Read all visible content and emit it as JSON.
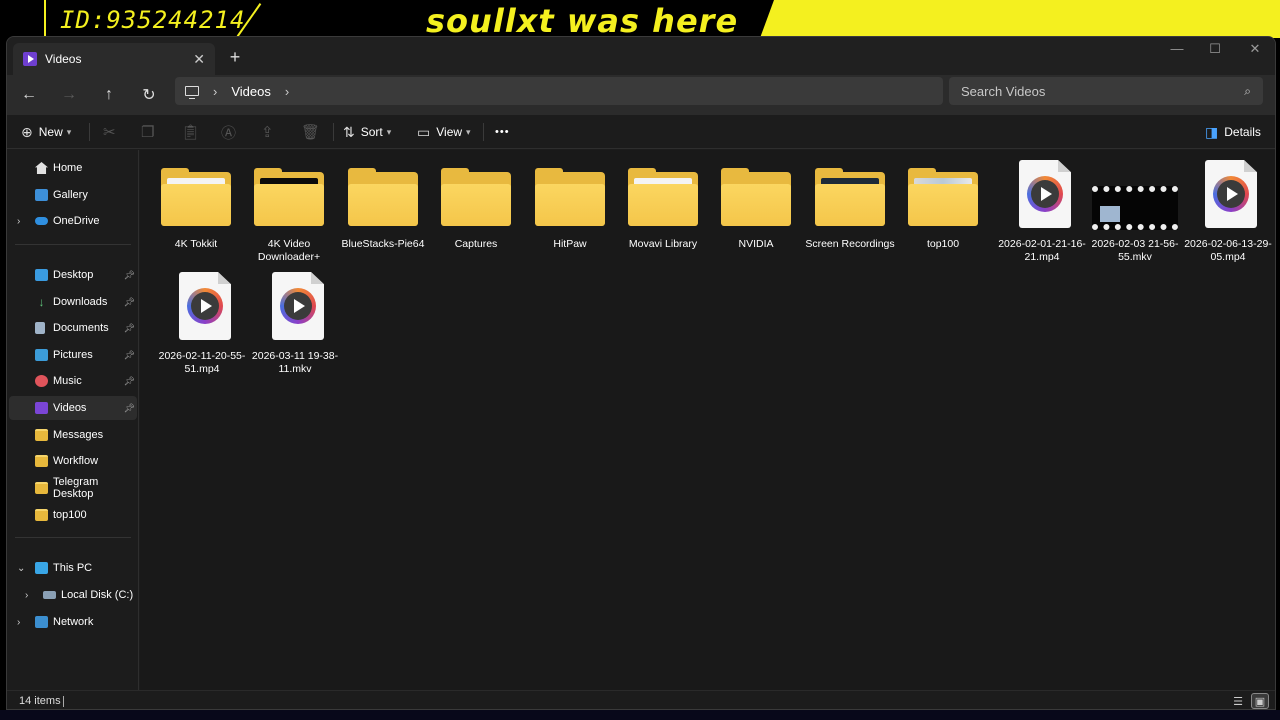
{
  "banner": {
    "id_text": "ID:935244214",
    "slogan": "soullxt was here"
  },
  "window": {
    "tab": {
      "label": "Videos",
      "close": "✕",
      "icon": "videos-icon"
    },
    "new_tab": "+",
    "controls": {
      "minimize": "—",
      "maximize": "☐",
      "close": "✕"
    }
  },
  "nav": {
    "back": "←",
    "forward": "→",
    "up": "↑",
    "refresh": "↻",
    "breadcrumb": [
      "Videos"
    ],
    "search_placeholder": "Search Videos"
  },
  "toolbar": {
    "new_label": "New",
    "sort_label": "Sort",
    "view_label": "View",
    "more_label": "•••",
    "details_label": "Details"
  },
  "sidebar": {
    "items": [
      {
        "label": "Home",
        "icon": "home-icon"
      },
      {
        "label": "Gallery",
        "icon": "gallery-icon"
      },
      {
        "label": "OneDrive",
        "icon": "cloud-icon"
      },
      {
        "label": "Desktop",
        "icon": "desktop-icon"
      },
      {
        "label": "Downloads",
        "icon": "download-icon"
      },
      {
        "label": "Documents",
        "icon": "documents-icon"
      },
      {
        "label": "Pictures",
        "icon": "pictures-icon"
      },
      {
        "label": "Music",
        "icon": "music-icon"
      },
      {
        "label": "Videos",
        "icon": "videos-icon"
      },
      {
        "label": "Messages",
        "icon": "folder-icon"
      },
      {
        "label": "Workflow",
        "icon": "folder-icon"
      },
      {
        "label": "Telegram Desktop",
        "icon": "folder-icon"
      },
      {
        "label": "top100",
        "icon": "folder-icon"
      },
      {
        "label": "This PC",
        "icon": "pc-icon"
      },
      {
        "label": "Local Disk (C:)",
        "icon": "disk-icon"
      },
      {
        "label": "Network",
        "icon": "network-icon"
      }
    ]
  },
  "files": [
    {
      "name": "4K Tokkit",
      "type": "folder"
    },
    {
      "name": "4K Video Downloader+",
      "type": "folder"
    },
    {
      "name": "BlueStacks-Pie64",
      "type": "folder"
    },
    {
      "name": "Captures",
      "type": "folder"
    },
    {
      "name": "HitPaw",
      "type": "folder"
    },
    {
      "name": "Movavi Library",
      "type": "folder"
    },
    {
      "name": "NVIDIA",
      "type": "folder"
    },
    {
      "name": "Screen Recordings",
      "type": "folder"
    },
    {
      "name": "top100",
      "type": "folder"
    },
    {
      "name": "2026-02-01-21-16-21.mp4",
      "type": "video"
    },
    {
      "name": "2026-02-03 21-56-55.mkv",
      "type": "video"
    },
    {
      "name": "2026-02-06-13-29-05.mp4",
      "type": "video"
    },
    {
      "name": "2026-02-11-20-55-51.mp4",
      "type": "video"
    },
    {
      "name": "2026-03-11 19-38-11.mkv",
      "type": "video"
    }
  ],
  "status": {
    "count": "14 items"
  },
  "colors": {
    "accent": "#7b45d6",
    "folder": "#f4c64a",
    "banner": "#f4f01f"
  }
}
